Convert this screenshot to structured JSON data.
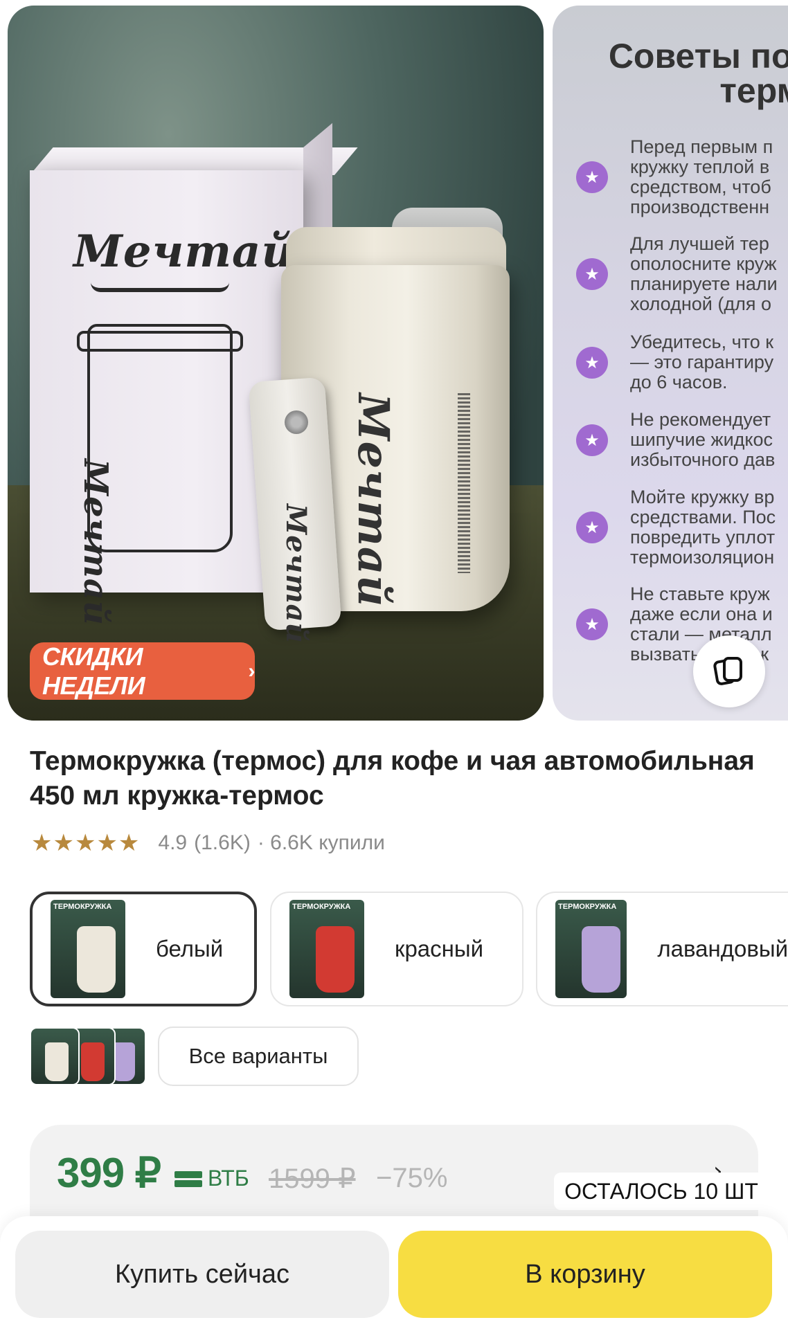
{
  "gallery": {
    "brand_text": "Мечтай",
    "promo_badge": {
      "label": "СКИДКИ НЕДЕЛИ",
      "chevron": "›"
    },
    "tips": {
      "title_line1": "Советы по и",
      "title_line2": "терм",
      "items": [
        {
          "icon": "star-icon",
          "text": "Перед первым п\nкружку теплой в\nсредством, чтоб\nпроизводственн"
        },
        {
          "icon": "star-icon",
          "text": "Для лучшей тер\nополосните круж\nпланируете нали\nхолодной (для о"
        },
        {
          "icon": "star-icon",
          "text": "Убедитесь, что к\n— это гарантиру\nдо 6 часов."
        },
        {
          "icon": "star-icon",
          "text": "Не рекомендует\nшипучие жидкос\nизбыточного дав"
        },
        {
          "icon": "star-icon",
          "text": "Мойте кружку вр\nсредствами. Пос\nповредить уплот\nтермоизоляцион"
        },
        {
          "icon": "star-icon",
          "text": "Не ставьте круж\nдаже если она и\nстали — металл\nвызвать повреж"
        }
      ]
    },
    "copy_icon": "copy-icon"
  },
  "product": {
    "title": "Термокружка (термос) для кофе и чая автомобильная 450 мл кружка-термос",
    "stars": "★★★★★",
    "rating": "4.9",
    "reviews": "(1.6K)",
    "bought": "· 6.6K купили"
  },
  "variants": [
    {
      "name": "белый",
      "color": "#ece7db",
      "thumb_label": "ТЕРМОКРУЖКА"
    },
    {
      "name": "красный",
      "color": "#d23a32",
      "thumb_label": "ТЕРМОКРУЖКА"
    },
    {
      "name": "лавандовый",
      "color": "#b6a3d8",
      "thumb_label": "ТЕРМОКРУЖКА"
    }
  ],
  "all_variants_label": "Все варианты",
  "price": {
    "current": "399 ₽",
    "bank": "ВТБ",
    "old": "1599 ₽",
    "discount": "−75%",
    "chevron": "›",
    "stock": "ОСТАЛОСЬ 10 ШТ"
  },
  "actions": {
    "buy_now": "Купить сейчас",
    "to_cart": "В корзину"
  },
  "colors": {
    "price_green": "#2f7d46",
    "cart_yellow": "#f7dd42",
    "promo_orange": "#e8603f",
    "star_gold": "#b8893d",
    "tip_purple": "#a06ad0"
  }
}
